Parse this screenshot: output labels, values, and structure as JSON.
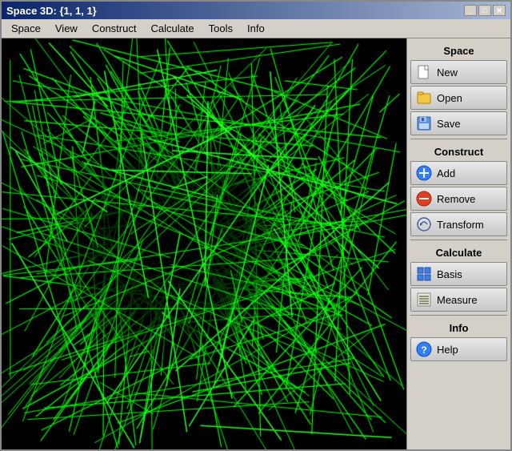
{
  "window": {
    "title": "Space 3D: {1, 1, 1}",
    "controls": {
      "minimize": "_",
      "maximize": "□",
      "close": "✕"
    }
  },
  "menu": {
    "items": [
      {
        "label": "Space"
      },
      {
        "label": "View"
      },
      {
        "label": "Construct"
      },
      {
        "label": "Calculate"
      },
      {
        "label": "Tools"
      },
      {
        "label": "Info"
      }
    ]
  },
  "right_panel": {
    "sections": [
      {
        "label": "Space",
        "buttons": [
          {
            "id": "new",
            "label": "New"
          },
          {
            "id": "open",
            "label": "Open"
          },
          {
            "id": "save",
            "label": "Save"
          }
        ]
      },
      {
        "label": "Construct",
        "buttons": [
          {
            "id": "add",
            "label": "Add"
          },
          {
            "id": "remove",
            "label": "Remove"
          },
          {
            "id": "transform",
            "label": "Transform"
          }
        ]
      },
      {
        "label": "Calculate",
        "buttons": [
          {
            "id": "basis",
            "label": "Basis"
          },
          {
            "id": "measure",
            "label": "Measure"
          }
        ]
      },
      {
        "label": "Info",
        "buttons": [
          {
            "id": "help",
            "label": "Help"
          }
        ]
      }
    ]
  },
  "colors": {
    "line_color": "#00ff00",
    "bg_color": "#000000"
  }
}
